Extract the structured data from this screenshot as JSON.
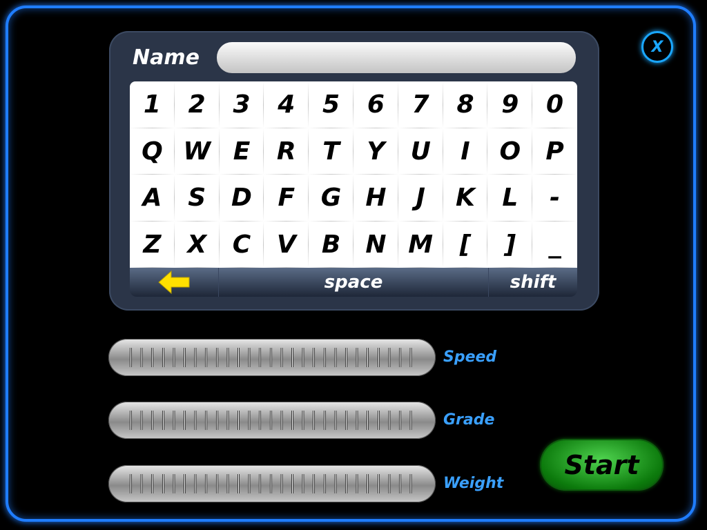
{
  "close": {
    "label": "X"
  },
  "name_field": {
    "label": "Name",
    "value": "",
    "placeholder": ""
  },
  "keyboard": {
    "rows": [
      [
        "1",
        "2",
        "3",
        "4",
        "5",
        "6",
        "7",
        "8",
        "9",
        "0"
      ],
      [
        "Q",
        "W",
        "E",
        "R",
        "T",
        "Y",
        "U",
        "I",
        "O",
        "P"
      ],
      [
        "A",
        "S",
        "D",
        "F",
        "G",
        "H",
        "J",
        "K",
        "L",
        "-"
      ],
      [
        "Z",
        "X",
        "C",
        "V",
        "B",
        "N",
        "M",
        "[",
        "]",
        "_"
      ]
    ],
    "backspace_icon": "left-arrow-icon",
    "space_label": "space",
    "shift_label": "shift"
  },
  "sliders": [
    {
      "label": "Speed"
    },
    {
      "label": "Grade"
    },
    {
      "label": "Weight"
    }
  ],
  "start": {
    "label": "Start"
  },
  "colors": {
    "frame": "#1f7dff",
    "label_blue": "#3aa0ff",
    "start_green": "#1fa01f",
    "arrow_yellow": "#ffe000"
  }
}
